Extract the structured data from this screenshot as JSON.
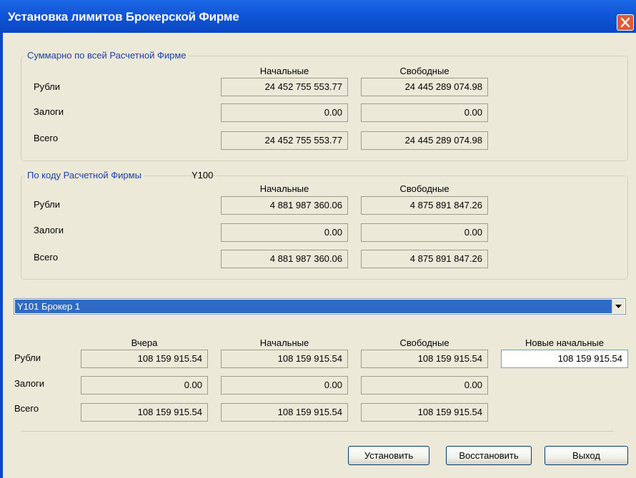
{
  "window": {
    "title": "Установка лимитов Брокерской Фирме",
    "close_icon": "close-icon"
  },
  "summary_group": {
    "legend": "Суммарно по всей Расчетной Фирме",
    "headers": {
      "initial": "Начальные",
      "free": "Свободные"
    },
    "rows": [
      {
        "label": "Рубли",
        "initial": "24 452 755 553.77",
        "free": "24 445 289 074.98"
      },
      {
        "label": "Залоги",
        "initial": "0.00",
        "free": "0.00"
      },
      {
        "label": "Всего",
        "initial": "24 452 755 553.77",
        "free": "24 445 289 074.98"
      }
    ]
  },
  "code_group": {
    "legend": "По коду Расчетной Фирмы",
    "code": "Y100",
    "headers": {
      "initial": "Начальные",
      "free": "Свободные"
    },
    "rows": [
      {
        "label": "Рубли",
        "initial": "4 881 987 360.06",
        "free": "4 875 891 847.26"
      },
      {
        "label": "Залоги",
        "initial": "0.00",
        "free": "0.00"
      },
      {
        "label": "Всего",
        "initial": "4 881 987 360.06",
        "free": "4 875 891 847.26"
      }
    ]
  },
  "broker_select": {
    "selected": "Y101   Брокер 1"
  },
  "broker": {
    "headers": {
      "yesterday": "Вчера",
      "initial": "Начальные",
      "free": "Свободные",
      "new_initial": "Новые начальные"
    },
    "rows": [
      {
        "label": "Рубли",
        "yesterday": "108 159 915.54",
        "initial": "108 159 915.54",
        "free": "108 159 915.54",
        "new_initial": "108 159 915.54"
      },
      {
        "label": "Залоги",
        "yesterday": "0.00",
        "initial": "0.00",
        "free": "0.00"
      },
      {
        "label": "Всего",
        "yesterday": "108 159 915.54",
        "initial": "108 159 915.54",
        "free": "108 159 915.54"
      }
    ]
  },
  "buttons": {
    "set": "Установить",
    "restore": "Восстановить",
    "exit": "Выход"
  },
  "colors": {
    "titlebar": "#0f56d8",
    "selection": "#316ac5",
    "legend_text": "#1b3fa8",
    "dialog_bg": "#ece9d8"
  }
}
